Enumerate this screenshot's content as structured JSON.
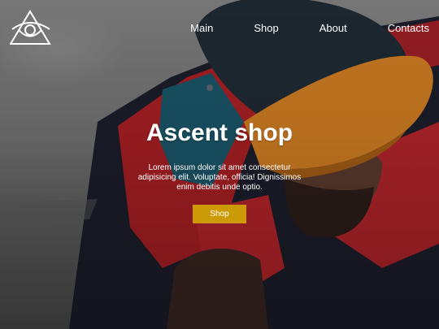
{
  "nav": {
    "items": [
      {
        "label": "Main"
      },
      {
        "label": "Shop"
      },
      {
        "label": "About"
      },
      {
        "label": "Contacts"
      }
    ]
  },
  "logo": {
    "icon": "eye-triangle-icon"
  },
  "hero": {
    "title": "Ascent shop",
    "description": "Lorem ipsum dolor sit amet consectetur adipisicing elit. Voluptate, officia! Dignissimos enim debitis unde optio.",
    "button_label": "Shop"
  },
  "colors": {
    "accent": "#cc9a06",
    "text": "#ffffff"
  }
}
